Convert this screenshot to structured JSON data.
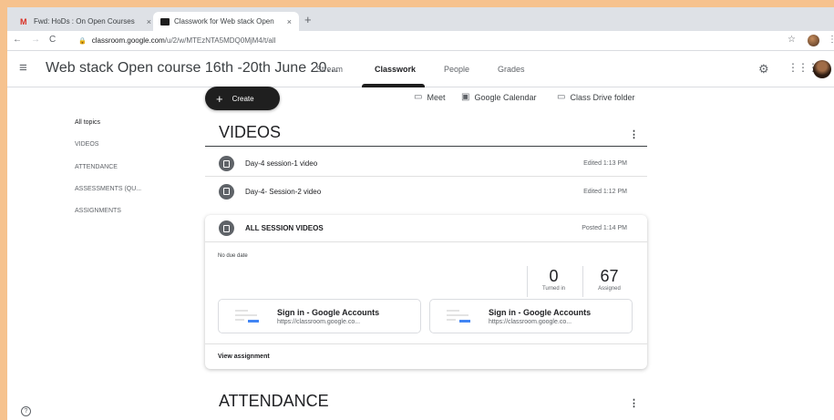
{
  "browser": {
    "tabs": [
      {
        "label": "Fwd: HoDs : On Open Courses",
        "favicon": "gmail-icon",
        "active": false
      },
      {
        "label": "Classwork for Web stack Open",
        "favicon": "classroom-icon",
        "active": true
      }
    ],
    "close_glyph": "×",
    "new_tab_glyph": "+",
    "url_host": "classroom.google.com",
    "url_path": "/u/2/w/MTEzNTA5MDQ0MjM4/t/all"
  },
  "header": {
    "course_title": "Web stack Open course 16th -20th June 20...",
    "tabs": [
      "Stream",
      "Classwork",
      "People",
      "Grades"
    ],
    "active_tab": "Classwork"
  },
  "actions": {
    "create_label": "Create",
    "meet_label": "Meet",
    "calendar_label": "Google Calendar",
    "drive_label": "Class Drive folder"
  },
  "sidebar": {
    "items": [
      "All topics",
      "VIDEOS",
      "ATTENDANCE",
      "ASSESSMENTS (QU...",
      "ASSIGNMENTS"
    ]
  },
  "topics": [
    {
      "title": "VIDEOS"
    },
    {
      "title": "ATTENDANCE"
    }
  ],
  "videos_items": [
    {
      "title": "Day-4 session-1 video",
      "meta": "Edited 1:13 PM"
    },
    {
      "title": "Day-4- Session-2 video",
      "meta": "Edited 1:12 PM"
    }
  ],
  "assignment_card": {
    "title": "ALL SESSION VIDEOS",
    "meta": "Posted 1:14 PM",
    "due": "No due date",
    "turned_in": {
      "value": "0",
      "label": "Turned in"
    },
    "assigned": {
      "value": "67",
      "label": "Assigned"
    },
    "attachments": [
      {
        "title": "Sign in - Google Accounts",
        "url": "https://classroom.google.co..."
      },
      {
        "title": "Sign in - Google Accounts",
        "url": "https://classroom.google.co..."
      }
    ],
    "footer_link": "View assignment"
  },
  "colors": {
    "page_border": "#f6c28e",
    "create_button": "#1f1f1f",
    "attachment_accent": "#4285f4"
  }
}
